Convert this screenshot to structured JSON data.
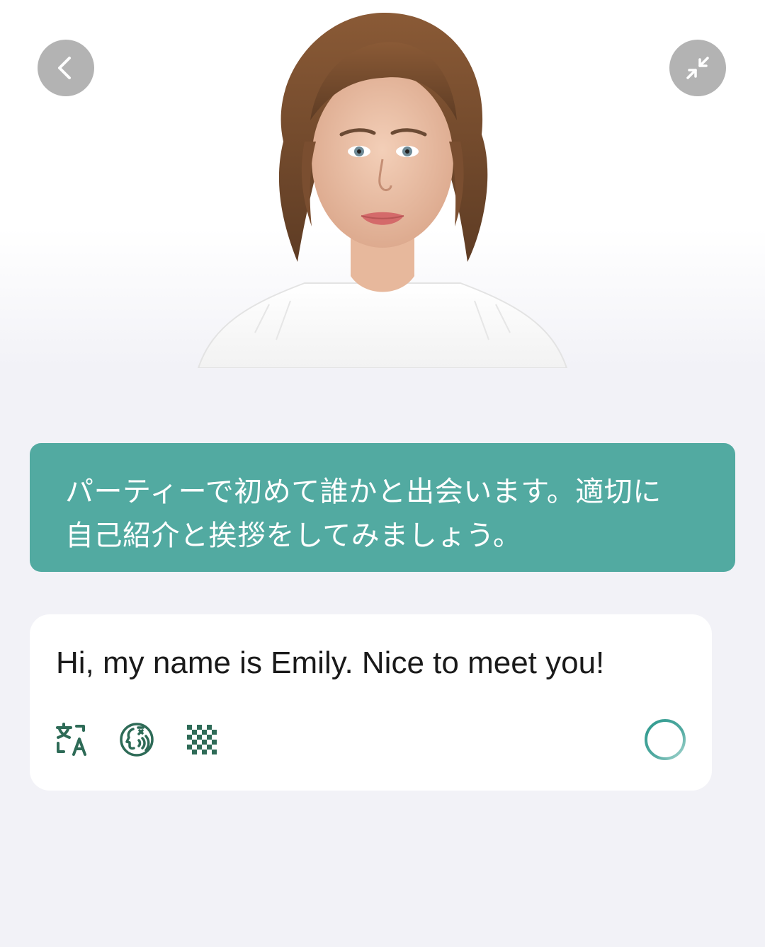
{
  "header": {
    "back_icon": "chevron-left-icon",
    "collapse_icon": "collapse-arrows-icon",
    "button_color": "#b3b3b3"
  },
  "avatar": {
    "description_icon": "avatar-portrait"
  },
  "prompt": {
    "text": "パーティーで初めて誰かと出会います。適切に\n自己紹介と挨拶をしてみましょう。",
    "background": "#52aaa1"
  },
  "answer": {
    "text": "Hi, my name is Emily. Nice to meet you!",
    "tools": [
      {
        "icon": "translate-icon"
      },
      {
        "icon": "speak-icon"
      },
      {
        "icon": "mosaic-icon"
      }
    ],
    "record_icon": "record-ring-icon",
    "accent": "#2e6b57"
  }
}
